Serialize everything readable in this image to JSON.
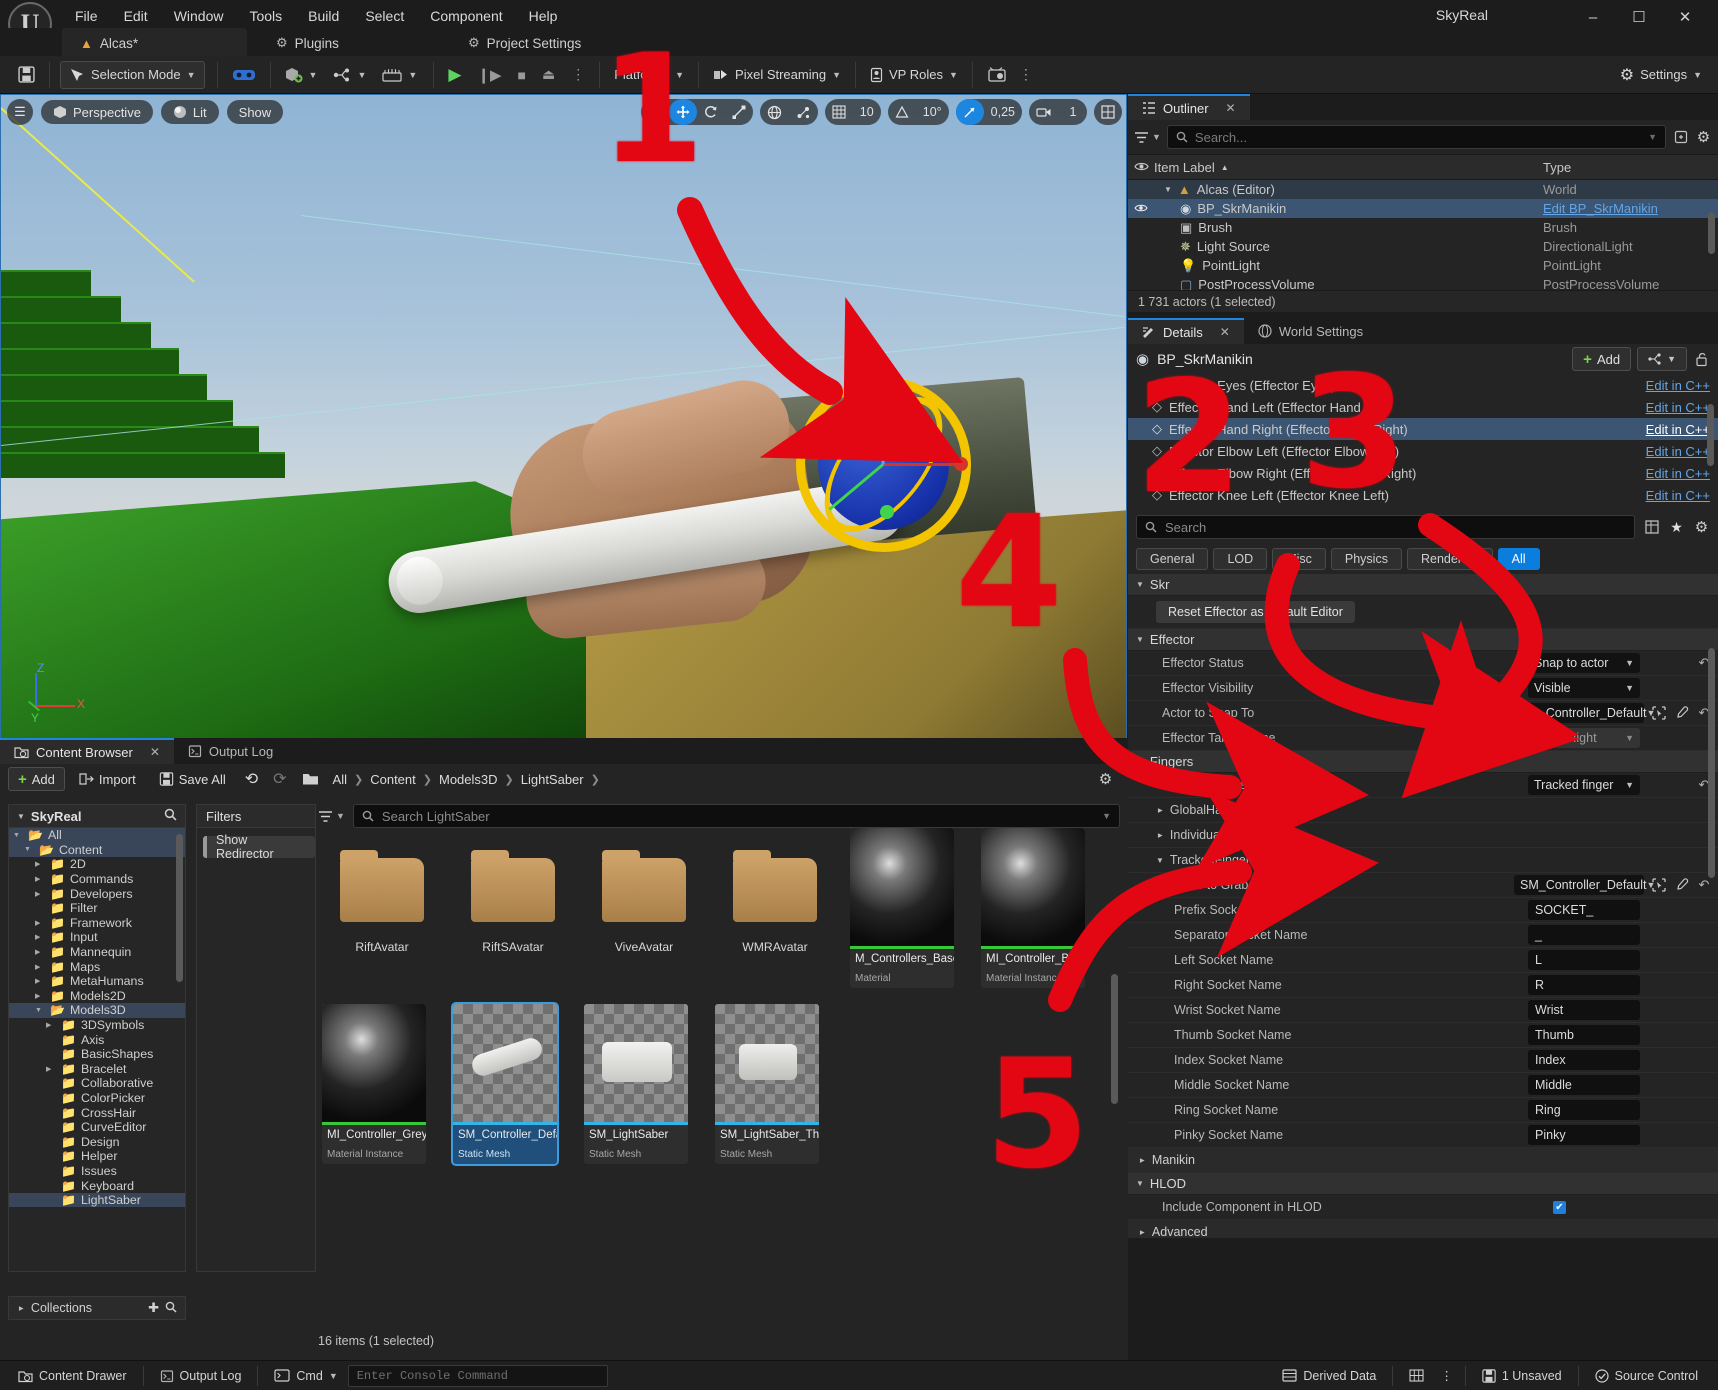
{
  "titlebar": {
    "logo": "unreal-logo",
    "menu": [
      "File",
      "Edit",
      "Window",
      "Tools",
      "Build",
      "Select",
      "Component",
      "Help"
    ],
    "window_title": "SkyReal",
    "minimize": "–",
    "maximize": "☐",
    "close": "✕"
  },
  "project_tabs": [
    {
      "label": "Alcas*",
      "icon": "level-icon",
      "active": true
    },
    {
      "label": "Plugins",
      "icon": "plugin-icon",
      "active": false
    },
    {
      "label": "Project Settings",
      "icon": "settings-icon",
      "active": false
    }
  ],
  "toolbar": {
    "save_icon": "save-icon",
    "mode_label": "Selection Mode",
    "vr_icon": "vr-headset-icon",
    "add_icon": "add-actor-icon",
    "blueprint_icon": "blueprints-icon",
    "sequencer_icon": "cinematics-icon",
    "play_icon": "▶",
    "step_icon": "❙▶",
    "stop_icon": "■",
    "eject_icon": "⏏",
    "more_icon": "⋮",
    "platforms_label": "Platforms",
    "pixel_streaming_label": "Pixel Streaming",
    "vp_roles_label": "VP Roles",
    "vp_icon": "virtual-production-icon",
    "settings_label": "Settings"
  },
  "viewport": {
    "menu_icon": "viewport-menu-icon",
    "perspective": "Perspective",
    "lit": "Lit",
    "show": "Show",
    "gizmo_select": "select-tool-icon",
    "gizmo_move": "move-tool-icon",
    "gizmo_rotate": "rotate-tool-icon",
    "gizmo_scale": "scale-tool-icon",
    "world_coord": "world-space-icon",
    "surface_snap": "surface-snap-icon",
    "grid_icon": "grid-snap-icon",
    "grid_value": "10",
    "angle_icon": "angle-snap-icon",
    "angle_value": "10°",
    "scale_icon": "scale-snap-icon",
    "scale_value": "0,25",
    "camera_icon": "camera-speed-icon",
    "camera_value": "1",
    "maximize_icon": "maximize-viewport-icon",
    "axis_x": "X",
    "axis_y": "Y",
    "axis_z": "Z"
  },
  "annotations": [
    {
      "number": "1"
    },
    {
      "number": "2"
    },
    {
      "number": "3"
    },
    {
      "number": "4"
    },
    {
      "number": "5"
    }
  ],
  "outliner": {
    "tab_label": "Outliner",
    "tab_icon": "outliner-icon",
    "close_icon": "✕",
    "filter_icon": "filter-icon",
    "search_icon": "search-icon",
    "search_placeholder": "Search...",
    "save_search_icon": "save-search-icon",
    "settings_icon": "gear-icon",
    "columns": {
      "eye": "eye-icon",
      "item_label": "Item Label",
      "sort": "▲",
      "type": "Type"
    },
    "rows": [
      {
        "label": "Alcas (Editor)",
        "type": "World",
        "icon": "world-icon",
        "indent": 1,
        "expanded": true,
        "eye": false,
        "state": "world"
      },
      {
        "label": "BP_SkrManikin",
        "type": "Edit BP_SkrManikin",
        "icon": "actor-icon",
        "indent": 2,
        "eye": true,
        "state": "selected",
        "type_is_link": true
      },
      {
        "label": "Brush",
        "type": "Brush",
        "icon": "brush-icon",
        "indent": 2,
        "eye": false,
        "state": ""
      },
      {
        "label": "Light Source",
        "type": "DirectionalLight",
        "icon": "sun-icon",
        "indent": 2,
        "eye": false,
        "state": ""
      },
      {
        "label": "PointLight",
        "type": "PointLight",
        "icon": "bulb-icon",
        "indent": 2,
        "eye": false,
        "state": ""
      },
      {
        "label": "PostProcessVolume",
        "type": "PostProcessVolume",
        "icon": "volume-icon",
        "indent": 2,
        "eye": false,
        "state": ""
      }
    ],
    "status": "1 731 actors (1 selected)"
  },
  "details": {
    "tabs": [
      {
        "label": "Details",
        "icon": "details-icon",
        "active": true,
        "close": "✕"
      },
      {
        "label": "World Settings",
        "icon": "world-settings-icon",
        "active": false
      }
    ],
    "actor_icon": "actor-icon",
    "actor_name": "BP_SkrManikin",
    "add_label": "Add",
    "hierarchy_icon": "hierarchy-icon",
    "lock_icon": "unlock-icon",
    "components": [
      {
        "label": "Effector Eyes (Effector Eyes)",
        "action": "Edit in C++",
        "selected": false
      },
      {
        "label": "Effector Hand Left (Effector Hand Left)",
        "action": "Edit in C++",
        "selected": false
      },
      {
        "label": "Effector Hand Right (Effector Hand Right)",
        "action": "Edit in C++",
        "selected": true
      },
      {
        "label": "Effector Elbow Left (Effector Elbow Left)",
        "action": "Edit in C++",
        "selected": false
      },
      {
        "label": "Effector Elbow Right (Effector Elbow Right)",
        "action": "Edit in C++",
        "selected": false
      },
      {
        "label": "Effector Knee Left (Effector Knee Left)",
        "action": "Edit in C++",
        "selected": false
      }
    ],
    "search_placeholder": "Search",
    "search_icon": "search-icon",
    "table_icon": "column-view-icon",
    "star_icon": "favorite-icon",
    "gear_icon": "gear-icon",
    "filters": [
      {
        "label": "General",
        "on": false
      },
      {
        "label": "LOD",
        "on": false
      },
      {
        "label": "Misc",
        "on": false
      },
      {
        "label": "Physics",
        "on": false
      },
      {
        "label": "Rendering",
        "on": false
      },
      {
        "label": "All",
        "on": true
      }
    ],
    "sections": {
      "skr": {
        "title": "Skr",
        "button": "Reset Effector as Default Editor"
      },
      "effector": {
        "title": "Effector",
        "rows": [
          {
            "label": "Effector Status",
            "value": "Snap to actor",
            "kind": "combo",
            "reset": true
          },
          {
            "label": "Effector Visibility",
            "value": "Visible",
            "kind": "combo",
            "reset": false
          },
          {
            "label": "Actor to Snap To",
            "value": "SM_Controller_Default",
            "kind": "combo-picker",
            "reset": true
          },
          {
            "label": "Effector Target Bone",
            "value": "Hand Right",
            "kind": "combo-disabled",
            "reset": false
          }
        ]
      },
      "fingers": {
        "title": "Fingers",
        "rows": [
          {
            "label": "Skr Hand State",
            "value": "Tracked finger",
            "kind": "combo",
            "reset": true
          }
        ],
        "groups": [
          {
            "title": "GlobalHand",
            "expanded": false
          },
          {
            "title": "IndividualFingers",
            "expanded": false
          },
          {
            "title": "TrackedFingers",
            "expanded": true
          }
        ]
      },
      "tracked_fingers": {
        "rows": [
          {
            "label": "Actor to Grab",
            "value": "SM_Controller_Default",
            "kind": "combo-picker",
            "reset": true
          },
          {
            "label": "Prefix Socket Name",
            "value": "SOCKET_",
            "kind": "text",
            "reset": false
          },
          {
            "label": "Separator Socket Name",
            "value": "_",
            "kind": "text",
            "reset": false
          },
          {
            "label": "Left Socket Name",
            "value": "L",
            "kind": "text",
            "reset": false
          },
          {
            "label": "Right Socket Name",
            "value": "R",
            "kind": "text",
            "reset": false
          },
          {
            "label": "Wrist Socket Name",
            "value": "Wrist",
            "kind": "text",
            "reset": false
          },
          {
            "label": "Thumb Socket Name",
            "value": "Thumb",
            "kind": "text",
            "reset": false
          },
          {
            "label": "Index Socket Name",
            "value": "Index",
            "kind": "text",
            "reset": false
          },
          {
            "label": "Middle Socket Name",
            "value": "Middle",
            "kind": "text",
            "reset": false
          },
          {
            "label": "Ring Socket Name",
            "value": "Ring",
            "kind": "text",
            "reset": false
          },
          {
            "label": "Pinky Socket Name",
            "value": "Pinky",
            "kind": "text",
            "reset": false
          }
        ]
      },
      "manikin": {
        "title": "Manikin",
        "expanded": false
      },
      "hlod": {
        "title": "HLOD",
        "rows": [
          {
            "label": "Include Component in HLOD",
            "value": "✔",
            "kind": "checkbox",
            "checked": true
          }
        ]
      },
      "advanced": {
        "title": "Advanced",
        "expanded": false
      }
    }
  },
  "content_browser": {
    "tabs": [
      {
        "label": "Content Browser",
        "icon": "content-browser-icon",
        "active": true,
        "close": "✕"
      },
      {
        "label": "Output Log",
        "icon": "output-log-icon",
        "active": false
      }
    ],
    "add_label": "Add",
    "import_label": "Import",
    "save_all_label": "Save All",
    "back_icon": "back-arrow-icon",
    "forward_icon": "forward-arrow-icon",
    "path_icon": "folder-icon",
    "breadcrumb": [
      "All",
      "Content",
      "Models3D",
      "LightSaber"
    ],
    "settings_icon": "gear-icon",
    "tree_root": "SkyReal",
    "tree_search_icon": "search-icon",
    "tree": [
      {
        "label": "All",
        "depth": 0,
        "arrow": "down",
        "sel": true
      },
      {
        "label": "Content",
        "depth": 1,
        "arrow": "down",
        "sel": true
      },
      {
        "label": "2D",
        "depth": 2,
        "arrow": "right",
        "sel": false
      },
      {
        "label": "Commands",
        "depth": 2,
        "arrow": "right",
        "sel": false
      },
      {
        "label": "Developers",
        "depth": 2,
        "arrow": "right",
        "sel": false
      },
      {
        "label": "Filter",
        "depth": 2,
        "arrow": "none",
        "sel": false
      },
      {
        "label": "Framework",
        "depth": 2,
        "arrow": "right",
        "sel": false
      },
      {
        "label": "Input",
        "depth": 2,
        "arrow": "right",
        "sel": false
      },
      {
        "label": "Mannequin",
        "depth": 2,
        "arrow": "right",
        "sel": false
      },
      {
        "label": "Maps",
        "depth": 2,
        "arrow": "right",
        "sel": false
      },
      {
        "label": "MetaHumans",
        "depth": 2,
        "arrow": "right",
        "sel": false
      },
      {
        "label": "Models2D",
        "depth": 2,
        "arrow": "right",
        "sel": false
      },
      {
        "label": "Models3D",
        "depth": 2,
        "arrow": "down",
        "sel": true
      },
      {
        "label": "3DSymbols",
        "depth": 3,
        "arrow": "right",
        "sel": false
      },
      {
        "label": "Axis",
        "depth": 3,
        "arrow": "none",
        "sel": false
      },
      {
        "label": "BasicShapes",
        "depth": 3,
        "arrow": "none",
        "sel": false
      },
      {
        "label": "Bracelet",
        "depth": 3,
        "arrow": "right",
        "sel": false
      },
      {
        "label": "Collaborative",
        "depth": 3,
        "arrow": "none",
        "sel": false
      },
      {
        "label": "ColorPicker",
        "depth": 3,
        "arrow": "none",
        "sel": false
      },
      {
        "label": "CrossHair",
        "depth": 3,
        "arrow": "none",
        "sel": false
      },
      {
        "label": "CurveEditor",
        "depth": 3,
        "arrow": "none",
        "sel": false
      },
      {
        "label": "Design",
        "depth": 3,
        "arrow": "none",
        "sel": false
      },
      {
        "label": "Helper",
        "depth": 3,
        "arrow": "none",
        "sel": false
      },
      {
        "label": "Issues",
        "depth": 3,
        "arrow": "none",
        "sel": false
      },
      {
        "label": "Keyboard",
        "depth": 3,
        "arrow": "none",
        "sel": false
      },
      {
        "label": "LightSaber",
        "depth": 3,
        "arrow": "none",
        "sel": true
      }
    ],
    "collections_label": "Collections",
    "collections_add_icon": "add-icon",
    "collections_search_icon": "search-icon",
    "filters_label": "Filters",
    "filter_chip": "Show Redirector",
    "view_options_icon": "view-options-icon",
    "asset_search_placeholder": "Search LightSaber",
    "assets": [
      {
        "name": "RiftAvatar",
        "kind": "folder"
      },
      {
        "name": "RiftSAvatar",
        "kind": "folder"
      },
      {
        "name": "ViveAvatar",
        "kind": "folder"
      },
      {
        "name": "WMRAvatar",
        "kind": "folder"
      },
      {
        "name": "M_Controllers_BaseMaterialStatic",
        "kind": "material",
        "type": "Material",
        "selected": false
      },
      {
        "name": "MI_Controller_Black",
        "kind": "material-instance",
        "type": "Material Instance",
        "selected": false
      },
      {
        "name": "MI_Controller_Grey",
        "kind": "material-instance",
        "type": "Material Instance",
        "selected": false
      },
      {
        "name": "SM_Controller_Default",
        "kind": "static-mesh",
        "type": "Static Mesh",
        "selected": true
      },
      {
        "name": "SM_LightSaber",
        "kind": "static-mesh",
        "type": "Static Mesh",
        "selected": false
      },
      {
        "name": "SM_LightSaber_Thin",
        "kind": "static-mesh",
        "type": "Static Mesh",
        "selected": false
      }
    ],
    "status": "16 items (1 selected)"
  },
  "statusbar": {
    "content_drawer": "Content Drawer",
    "content_drawer_icon": "drawer-icon",
    "output_log": "Output Log",
    "output_log_icon": "output-log-icon",
    "cmd_label": "Cmd",
    "console_placeholder": "Enter Console Command",
    "derived_data": "Derived Data",
    "derived_data_icon": "derived-data-icon",
    "grid_icon": "grid-icon",
    "more_icon": "⋮",
    "unsaved": "1 Unsaved",
    "unsaved_icon": "save-icon",
    "source_control": "Source Control",
    "source_control_icon": "source-control-icon"
  }
}
